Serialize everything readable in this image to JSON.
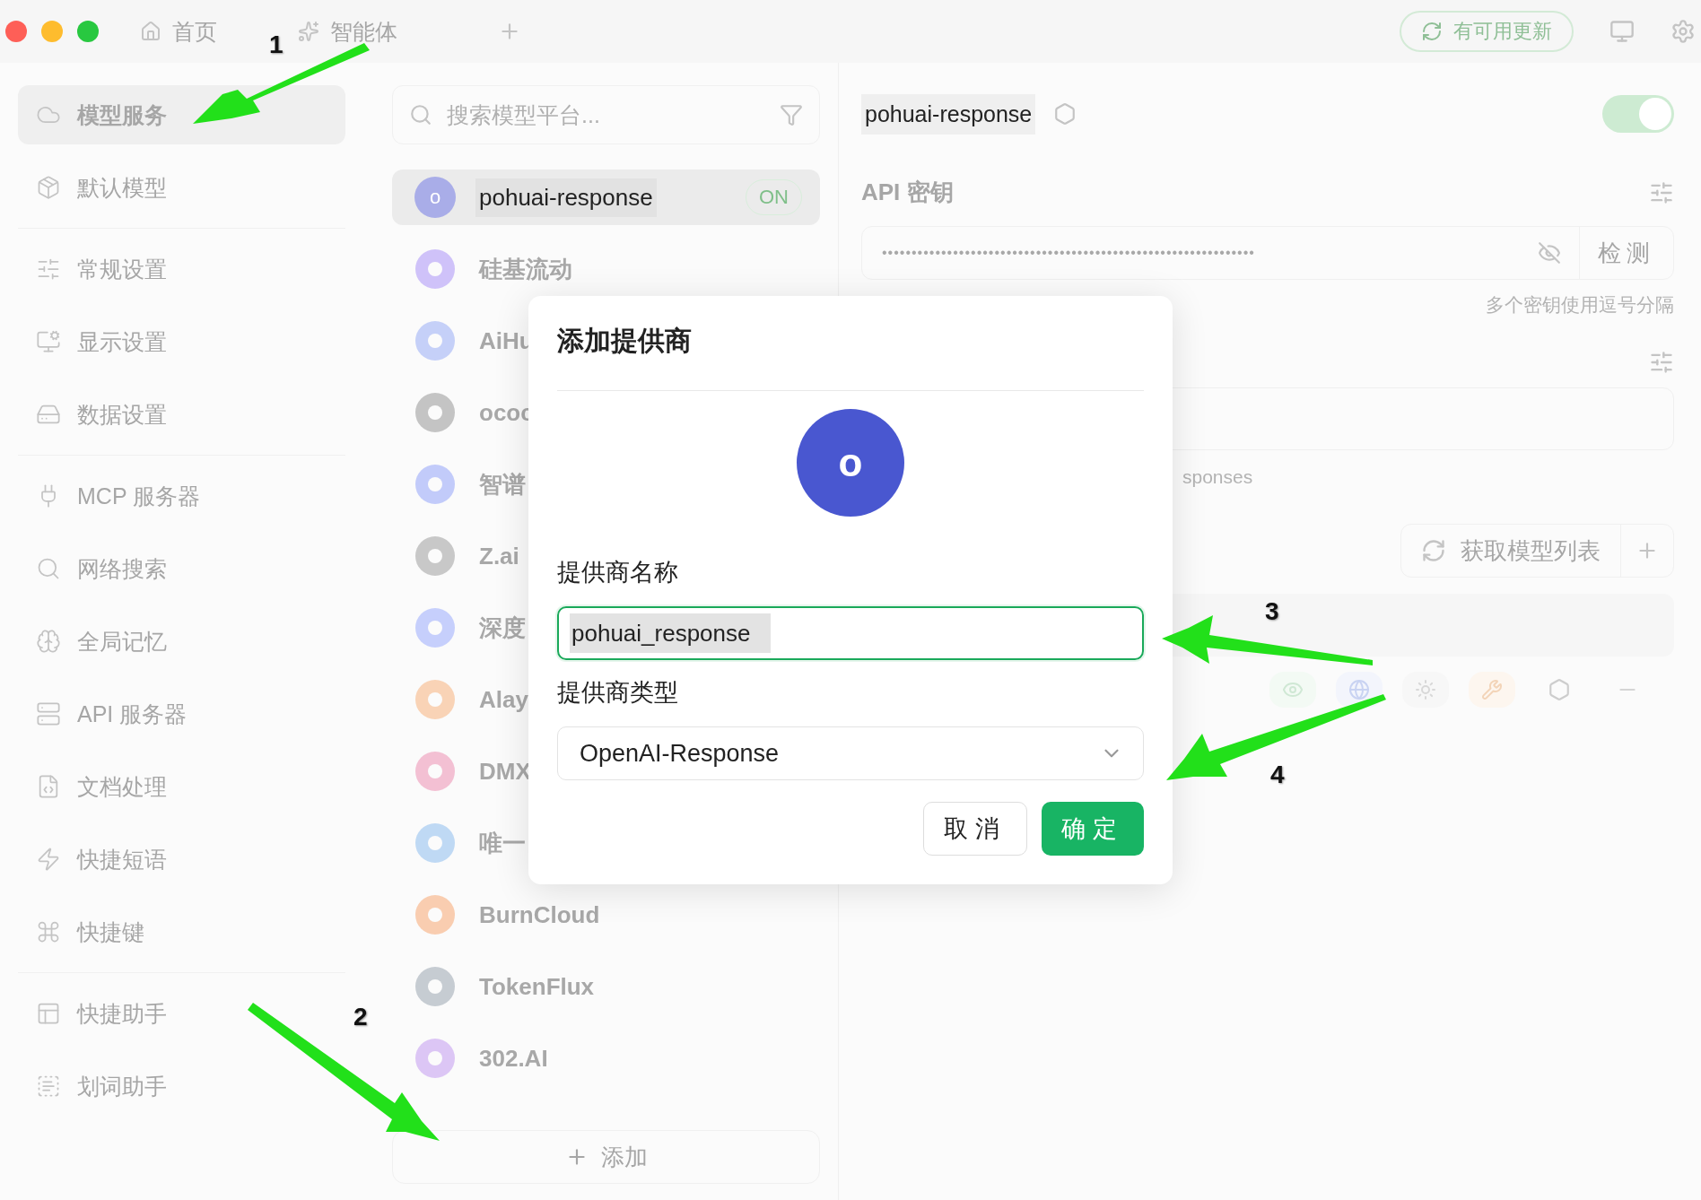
{
  "top_bar": {
    "tabs": [
      {
        "label": "首页"
      },
      {
        "label": "智能体"
      }
    ],
    "update_button": "有可用更新"
  },
  "sidebar": {
    "groups": [
      {
        "items": [
          {
            "label": "模型服务",
            "selected": true
          },
          {
            "label": "默认模型",
            "selected": false
          }
        ]
      },
      {
        "items": [
          {
            "label": "常规设置",
            "selected": false
          },
          {
            "label": "显示设置",
            "selected": false
          },
          {
            "label": "数据设置",
            "selected": false
          }
        ]
      },
      {
        "items": [
          {
            "label": "MCP 服务器",
            "selected": false
          },
          {
            "label": "网络搜索",
            "selected": false
          },
          {
            "label": "全局记忆",
            "selected": false
          },
          {
            "label": "API 服务器",
            "selected": false
          },
          {
            "label": "文档处理",
            "selected": false
          },
          {
            "label": "快捷短语",
            "selected": false
          },
          {
            "label": "快捷键",
            "selected": false
          }
        ]
      },
      {
        "items": [
          {
            "label": "快捷助手",
            "selected": false
          },
          {
            "label": "划词助手",
            "selected": false
          }
        ]
      }
    ]
  },
  "provider_list": {
    "search": {
      "placeholder": "搜索模型平台..."
    },
    "items": [
      {
        "name": "pohuai-response",
        "selected": true,
        "avatar": "o",
        "badge": "ON",
        "color": "#a9ade8"
      },
      {
        "name": "硅基流动",
        "selected": false,
        "color": "#cfc2f9"
      },
      {
        "name": "AiHu",
        "selected": false,
        "color": "#c5d0f8"
      },
      {
        "name": "ococ",
        "selected": false,
        "color": "#c4c4c4"
      },
      {
        "name": "智谱",
        "selected": false,
        "color": "#c2cbfa"
      },
      {
        "name": "Z.ai",
        "selected": false,
        "color": "#c8c8c8"
      },
      {
        "name": "深度",
        "selected": false,
        "color": "#c6cffc"
      },
      {
        "name": "Alay",
        "selected": false,
        "color": "#f9d3b6"
      },
      {
        "name": "DMX",
        "selected": false,
        "color": "#f3c0d3"
      },
      {
        "name": "唯一",
        "selected": false,
        "color": "#bfd9f4"
      },
      {
        "name": "BurnCloud",
        "selected": false,
        "color": "#f9cdb0"
      },
      {
        "name": "TokenFlux",
        "selected": false,
        "color": "#c6ccd2"
      },
      {
        "name": "302.AI",
        "selected": false,
        "color": "#dcc6f5"
      }
    ],
    "add_button": "添加"
  },
  "provider_detail": {
    "name": "pohuai-response",
    "enabled": true,
    "api_key": {
      "title": "API 密钥",
      "masked_value": "•••••••••••••••••••••••••••••••••••••••••••••••••••••••••••••••",
      "check_button": "检测",
      "hint": "多个密钥使用逗号分隔"
    },
    "api_url_hint": "sponses",
    "fetch_models_button": "获取模型列表"
  },
  "dialog": {
    "title": "添加提供商",
    "avatar": "o",
    "name_label": "提供商名称",
    "name_value": "pohuai_response",
    "type_label": "提供商类型",
    "type_value": "OpenAI-Response",
    "cancel_button": "取消",
    "ok_button": "确定"
  },
  "annotations": [
    {
      "label": "1"
    },
    {
      "label": "2"
    },
    {
      "label": "3"
    },
    {
      "label": "4"
    }
  ]
}
